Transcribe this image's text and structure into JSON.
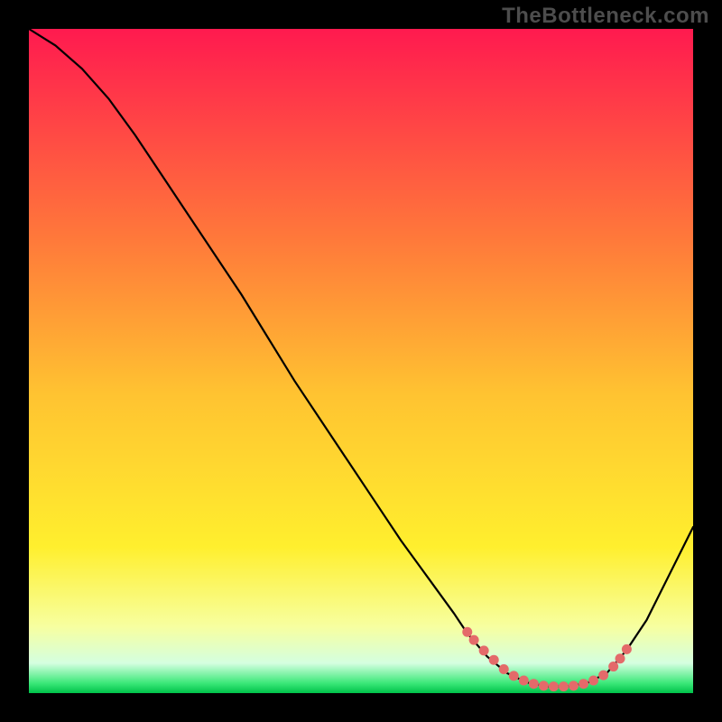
{
  "watermark": {
    "text": "TheBottleneck.com"
  },
  "chart_data": {
    "type": "line",
    "title": "",
    "xlabel": "",
    "ylabel": "",
    "xlim": [
      0,
      100
    ],
    "ylim": [
      0,
      100
    ],
    "grid": false,
    "legend": false,
    "background_gradient": {
      "top_color": "#ff1a4f",
      "mid_color": "#ffe400",
      "bottom_color": "#00c24a",
      "stops": [
        {
          "offset": 0.0,
          "color": "#ff1a4f"
        },
        {
          "offset": 0.32,
          "color": "#ff7a3a"
        },
        {
          "offset": 0.55,
          "color": "#ffc331"
        },
        {
          "offset": 0.78,
          "color": "#ffef2e"
        },
        {
          "offset": 0.9,
          "color": "#f7ffa0"
        },
        {
          "offset": 0.955,
          "color": "#d4ffe0"
        },
        {
          "offset": 0.985,
          "color": "#3be879"
        },
        {
          "offset": 1.0,
          "color": "#00c24a"
        }
      ]
    },
    "series": [
      {
        "name": "bottleneck-curve",
        "color": "#000000",
        "x": [
          0,
          4,
          8,
          12,
          16,
          20,
          24,
          28,
          32,
          36,
          40,
          44,
          48,
          52,
          56,
          60,
          64,
          66,
          69,
          72,
          75,
          78,
          81,
          84,
          87,
          90,
          93,
          96,
          100
        ],
        "y": [
          100,
          97.5,
          94,
          89.5,
          84,
          78,
          72,
          66,
          60,
          53.5,
          47,
          41,
          35,
          29,
          23,
          17.5,
          12,
          9,
          5.5,
          3,
          1.6,
          1.0,
          1.0,
          1.5,
          3,
          6.5,
          11,
          17,
          25
        ]
      },
      {
        "name": "optimal-range-markers",
        "color": "#e46a6a",
        "marker_only": true,
        "x": [
          66,
          67,
          68.5,
          70,
          71.5,
          73,
          74.5,
          76,
          77.5,
          79,
          80.5,
          82,
          83.5,
          85,
          86.5,
          88,
          89,
          90
        ],
        "y": [
          9.2,
          8.0,
          6.4,
          5.0,
          3.6,
          2.6,
          1.9,
          1.4,
          1.1,
          1.0,
          1.0,
          1.1,
          1.4,
          1.9,
          2.7,
          4.0,
          5.2,
          6.6
        ]
      }
    ],
    "annotations": []
  }
}
